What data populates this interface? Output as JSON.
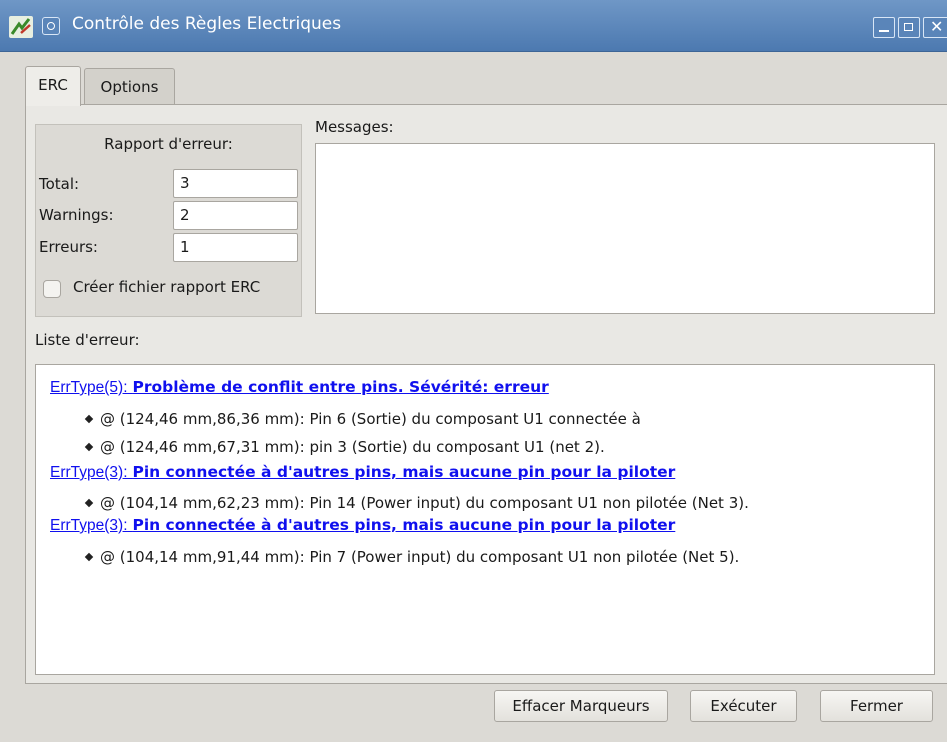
{
  "window": {
    "title": "Contrôle des Règles Electriques"
  },
  "tabs": [
    {
      "label": "ERC",
      "active": true
    },
    {
      "label": "Options",
      "active": false
    }
  ],
  "report": {
    "title": "Rapport d'erreur:",
    "total_label": "Total:",
    "total_value": "3",
    "warnings_label": "Warnings:",
    "warnings_value": "2",
    "errors_label": "Erreurs:",
    "errors_value": "1",
    "create_report_label": "Créer fichier rapport ERC",
    "create_report_checked": false
  },
  "messages": {
    "label": "Messages:",
    "content": ""
  },
  "error_list": {
    "label": "Liste d'erreur:",
    "entries": [
      {
        "type": "ErrType(5):",
        "description": "Problème de conflit entre pins. Sévérité: erreur",
        "items": [
          "@ (124,46 mm,86,36 mm): Pin 6 (Sortie) du composant U1 connectée à",
          "@ (124,46 mm,67,31 mm): pin 3 (Sortie) du composant U1 (net 2)."
        ]
      },
      {
        "type": "ErrType(3):",
        "description": "Pin connectée à d'autres pins, mais aucune pin pour la piloter",
        "items": [
          "@ (104,14 mm,62,23 mm): Pin 14 (Power input) du composant U1 non pilotée (Net 3)."
        ]
      },
      {
        "type": "ErrType(3):",
        "description": "Pin connectée à d'autres pins, mais aucune pin pour la piloter",
        "items": [
          "@ (104,14 mm,91,44 mm): Pin 7 (Power input) du composant U1 non pilotée (Net 5)."
        ]
      }
    ]
  },
  "buttons": {
    "clear_markers": "Effacer Marqueurs",
    "run": "Exécuter",
    "close": "Fermer"
  },
  "colors": {
    "titlebar": "#5a85b9",
    "link": "#1010ee"
  }
}
